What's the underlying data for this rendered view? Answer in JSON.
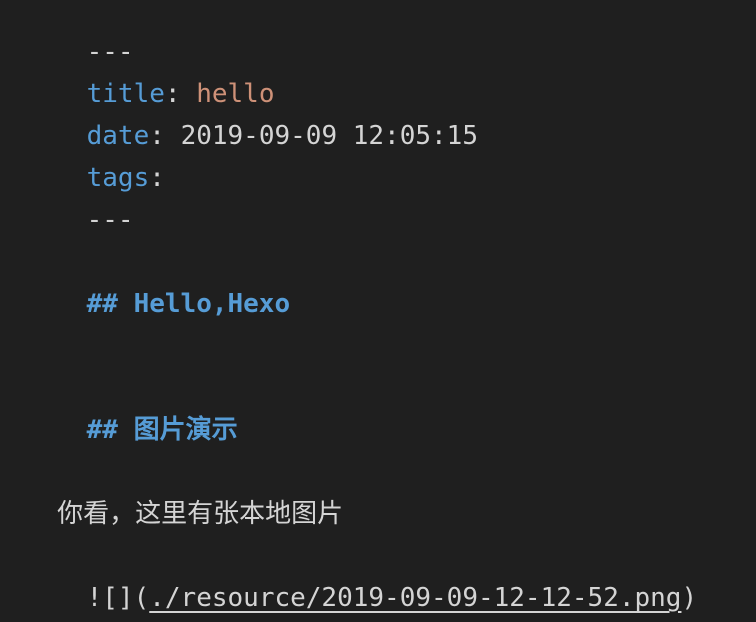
{
  "front_matter": {
    "delimiter": "---",
    "title_key": "title",
    "title_value": "hello",
    "date_key": "date",
    "date_value": "2019-09-09 12:05:15",
    "tags_key": "tags",
    "separator": ":"
  },
  "content": {
    "heading1": "## Hello,Hexo",
    "heading2_marker": "##",
    "heading2_text": "图片演示",
    "paragraph": "你看，这里有张本地图片",
    "image_prefix": "![](",
    "image_url": "./resource/2019-09-09-12-12-52.png",
    "image_suffix": ")"
  },
  "colors": {
    "background": "#1f1f1f",
    "key": "#569cd6",
    "string": "#ce9178",
    "text": "#d4d4d4"
  }
}
